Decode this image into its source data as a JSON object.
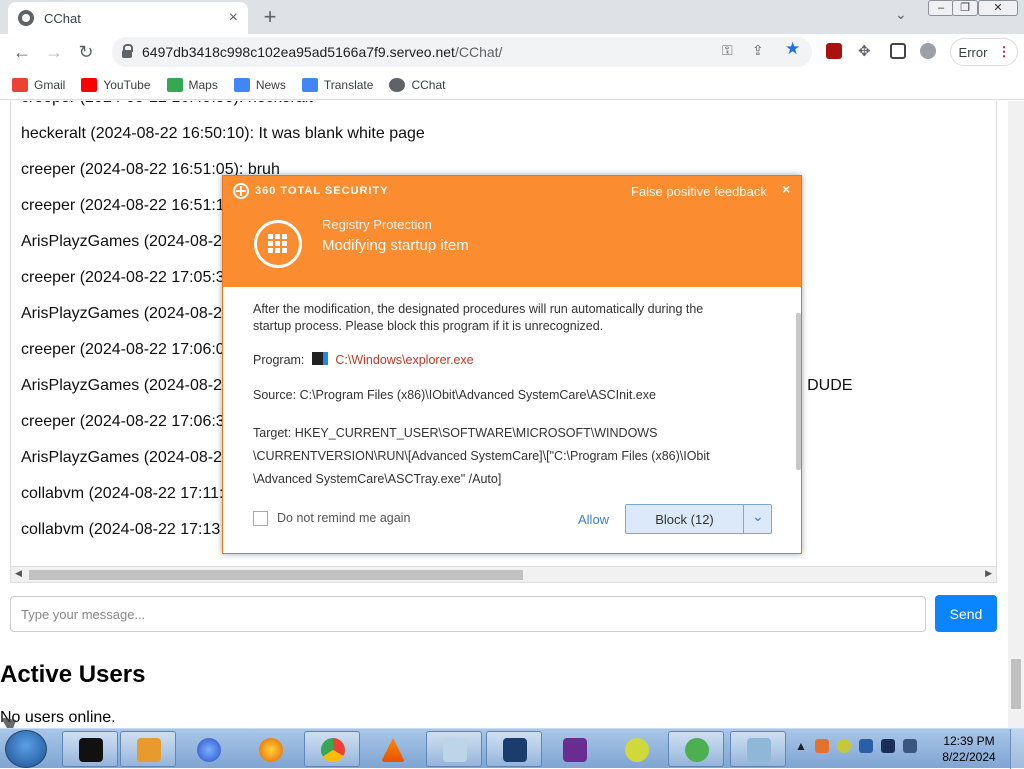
{
  "browser": {
    "tab_title": "CChat",
    "url_host": "6497db3418c998c102ea95ad5166a7f9.serveo.net",
    "url_path": "/CChat/",
    "error_label": "Error",
    "bookmarks": [
      "Gmail",
      "YouTube",
      "Maps",
      "News",
      "Translate",
      "CChat"
    ]
  },
  "chat": {
    "messages": [
      "heckeralt (2024-08-22 16:50:10): It was blank white page",
      "creeper (2024-08-22 16:51:05): bruh",
      "creeper (2024-08-22 16:51:1",
      "ArisPlayzGames (2024-08-2",
      "creeper (2024-08-22 17:05:3",
      "ArisPlayzGames (2024-08-2",
      "creeper (2024-08-22 17:06:0",
      "ArisPlayzGames (2024-08-2",
      "creeper (2024-08-22 17:06:3",
      "ArisPlayzGames (2024-08-2",
      "collabvm (2024-08-22 17:11:",
      "collabvm (2024-08-22 17:13"
    ],
    "overflow_text": "E DUDE",
    "input_placeholder": "Type your message...",
    "send_label": "Send",
    "active_users_heading": "Active Users",
    "no_users_text": "No users online."
  },
  "popup": {
    "brand": "360 TOTAL SECURITY",
    "false_positive": "False positive feedback",
    "close": "×",
    "title": "Registry Protection",
    "subtitle": "Modifying startup item",
    "description_1": "After the modification, the designated procedures will run automatically during the",
    "description_2": "startup process. Please block this program if it is unrecognized.",
    "program_label": "Program:",
    "program_value": "C:\\Windows\\explorer.exe",
    "source_label": "Source:",
    "source_value": "C:\\Program Files (x86)\\IObit\\Advanced SystemCare\\ASCInit.exe",
    "target_label": "Target:",
    "target_line1": "HKEY_CURRENT_USER\\SOFTWARE\\MICROSOFT\\WINDOWS",
    "target_line2": "\\CURRENTVERSION\\RUN\\[Advanced SystemCare]\\[\"C:\\Program Files (x86)\\IObit",
    "target_line3": "\\Advanced SystemCare\\ASCTray.exe\" /Auto]",
    "dont_remind": "Do not remind me again",
    "allow": "Allow",
    "block": "Block (12)"
  },
  "taskbar": {
    "time": "12:39 PM",
    "date": "8/22/2024"
  },
  "colors": {
    "popup_orange": "#fb8c30",
    "send_blue": "#0a84ff",
    "star_blue": "#1a73e8"
  }
}
